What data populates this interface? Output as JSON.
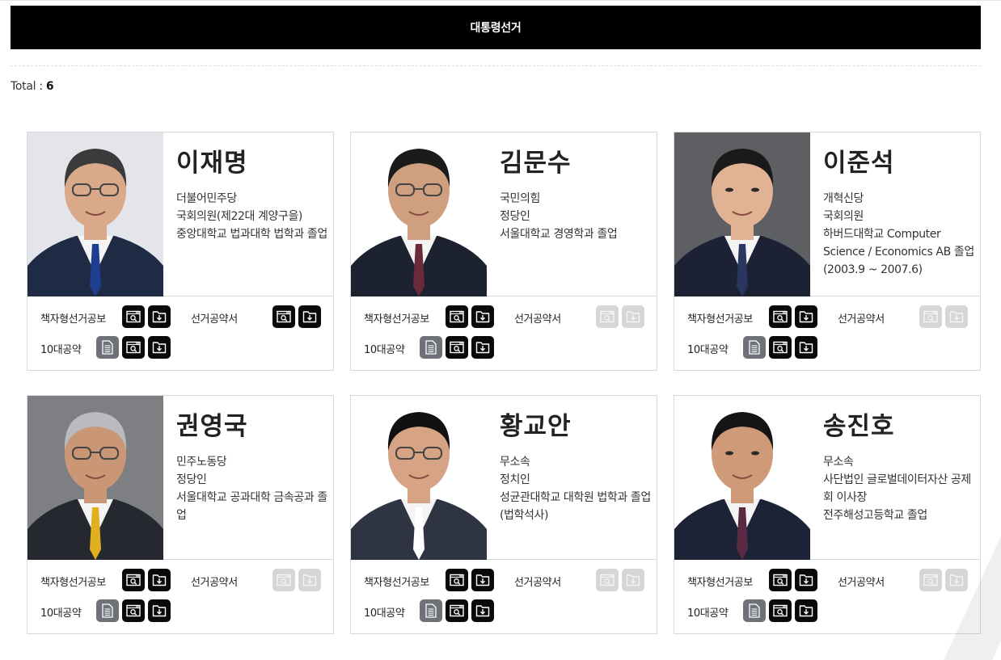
{
  "tab": {
    "label": "대통령선거"
  },
  "total": {
    "label": "Total :",
    "count": "6"
  },
  "labels": {
    "booklet": "책자형선거공보",
    "pledge_book": "선거공약서",
    "top10": "10대공약"
  },
  "candidates": [
    {
      "name": "이재명",
      "lines": [
        "더불어민주당",
        "국회의원(제22대 계양구을)",
        "중앙대학교 법과대학 법학과 졸업"
      ],
      "pledge_book_available": true
    },
    {
      "name": "김문수",
      "lines": [
        "국민의힘",
        "정당인",
        "서울대학교 경영학과 졸업"
      ],
      "pledge_book_available": false
    },
    {
      "name": "이준석",
      "lines": [
        "개혁신당",
        "국회의원",
        "하버드대학교 Computer Science / Economics AB 졸업(2003.9 ~ 2007.6)"
      ],
      "pledge_book_available": false
    },
    {
      "name": "권영국",
      "lines": [
        "민주노동당",
        "정당인",
        "서울대학교 공과대학 금속공과 졸업"
      ],
      "pledge_book_available": false
    },
    {
      "name": "황교안",
      "lines": [
        "무소속",
        "정치인",
        "성균관대학교 대학원 법학과 졸업(법학석사)"
      ],
      "pledge_book_available": false
    },
    {
      "name": "송진호",
      "lines": [
        "무소속",
        "사단법인 글로벌데이터자산 공제회 이사장",
        "전주해성고등학교 졸업"
      ],
      "pledge_book_available": false
    }
  ],
  "icons": {
    "view": "document-view-icon",
    "download": "download-icon",
    "text": "text-document-icon"
  },
  "colors": {
    "tab_bg": "#000000",
    "btn_active": "#0a0a0a",
    "btn_text": "#6f7178",
    "btn_disabled": "#d6d6d6"
  }
}
